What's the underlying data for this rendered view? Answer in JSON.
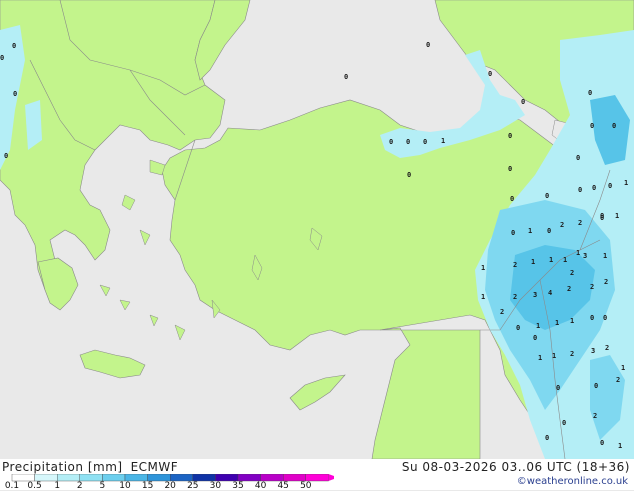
{
  "map": {
    "value_labels": [
      "0",
      "0",
      "0",
      "0",
      "0",
      "0",
      "0",
      "0",
      "0",
      "0",
      "0",
      "1",
      "0",
      "0",
      "0",
      "0",
      "0",
      "0",
      "0",
      "0",
      "0",
      "0",
      "0",
      "1",
      "2",
      "0",
      "1",
      "0",
      "0",
      "1",
      "2",
      "1",
      "1",
      "2",
      "1",
      "1",
      "1",
      "2",
      "2",
      "2",
      "1",
      "3",
      "1",
      "2",
      "3",
      "4",
      "2",
      "2",
      "1",
      "1",
      "1",
      "0",
      "0",
      "0",
      "0",
      "1",
      "1",
      "2",
      "3",
      "2",
      "1",
      "2",
      "0",
      "0",
      "0",
      "0",
      "0",
      "1",
      "2",
      "0",
      "0"
    ],
    "colors": {
      "land": "#c3f48c",
      "sea": "#e9e9e9",
      "border": "#8a8a8a",
      "precip_light": "#b4eef6",
      "precip_mid": "#7fd8f0",
      "precip_heavy": "#57c4e8"
    }
  },
  "footer": {
    "title": "Precipitation [mm]",
    "model": "ECMWF",
    "valid": "Su 08-03-2026 03..06 UTC (18+36)",
    "credit": "©weatheronline.co.uk"
  },
  "legend": {
    "ticks": [
      "0.1",
      "0.5",
      "1",
      "2",
      "5",
      "10",
      "15",
      "20",
      "25",
      "30",
      "35",
      "40",
      "45",
      "50"
    ],
    "colors": [
      "#ffffff",
      "#d6f7fb",
      "#b4eef6",
      "#8fe1f3",
      "#6ccfee",
      "#4bb6e6",
      "#2f95da",
      "#1c64c4",
      "#0f33a6",
      "#3f00b0",
      "#8200c4",
      "#b900c8",
      "#e000c8",
      "#ff00d8"
    ]
  }
}
